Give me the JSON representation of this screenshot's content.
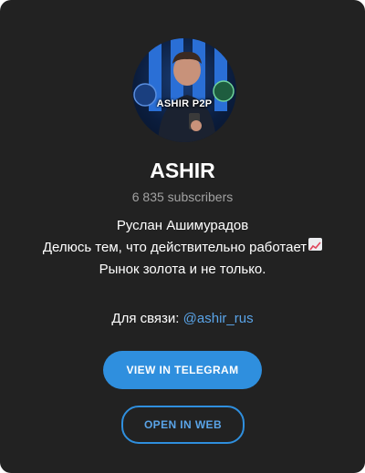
{
  "channel": {
    "avatar_label": "ASHIR P2P",
    "title": "ASHIR",
    "subscribers": "6 835 subscribers",
    "description_lines": [
      "Руслан Ашимурадов",
      "Делюсь тем, что действительно работает",
      "Рынок золота и не только."
    ],
    "trend_emoji": "chart-increasing-icon",
    "contact_label": "Для связи:",
    "contact_handle": "@ashir_rus"
  },
  "actions": {
    "view_label": "VIEW IN TELEGRAM",
    "web_label": "OPEN IN WEB"
  },
  "colors": {
    "card_background": "#222222",
    "accent": "#2f8fde",
    "link": "#5aa4e8",
    "muted_text": "#a2a2a2"
  }
}
